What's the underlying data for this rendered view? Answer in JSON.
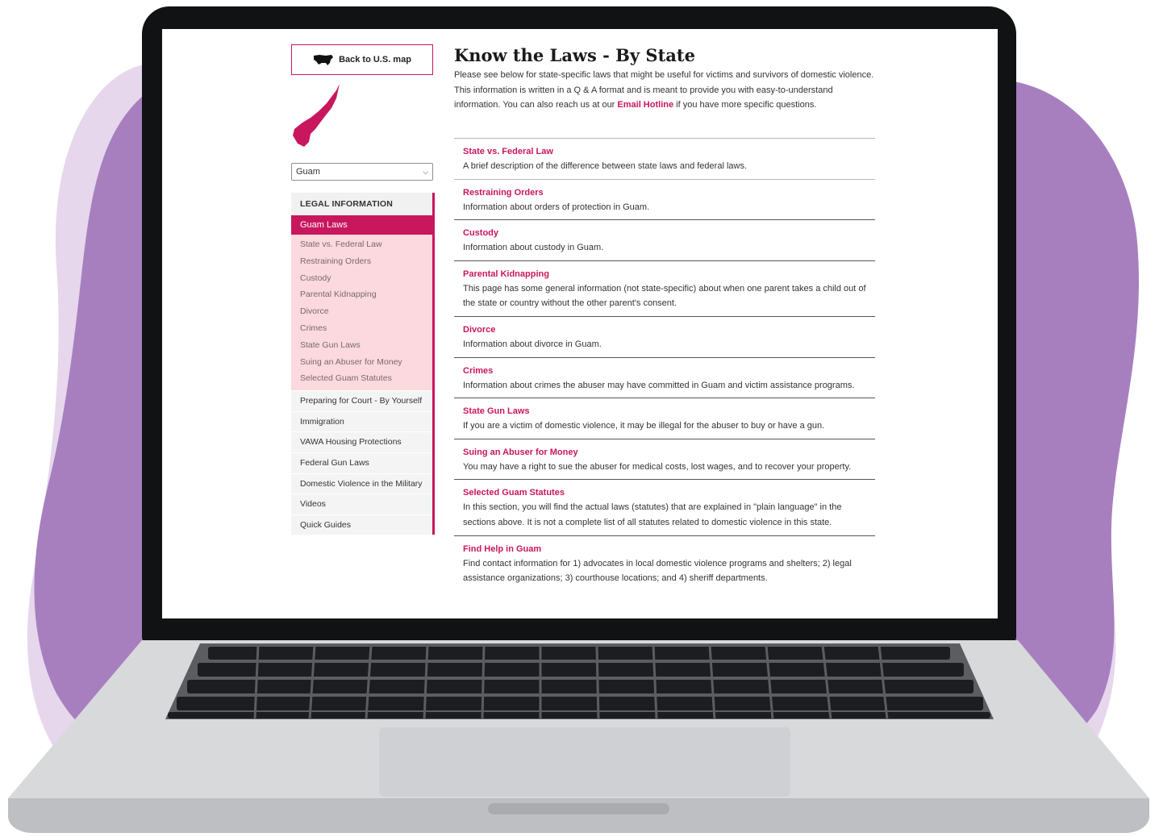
{
  "page": {
    "back_button": "Back to U.S. map",
    "selected_state": "Guam",
    "title": "Know the Laws - By State",
    "intro_before": "Please see below for state-specific laws that might be useful for victims and survivors of domestic violence. This information is written in a Q & A format and is meant to provide you with easy-to-understand information. You can also reach us at our ",
    "intro_link": "Email Hotline",
    "intro_after": " if you have more specific questions."
  },
  "sidebar": {
    "heading": "LEGAL INFORMATION",
    "active": "Guam Laws",
    "sub_items": [
      "State vs. Federal Law",
      "Restraining Orders",
      "Custody",
      "Parental Kidnapping",
      "Divorce",
      "Crimes",
      "State Gun Laws",
      "Suing an Abuser for Money",
      "Selected Guam Statutes"
    ],
    "items": [
      "Preparing for Court - By Yourself",
      "Immigration",
      "VAWA Housing Protections",
      "Federal Gun Laws",
      "Domestic Violence in the Military",
      "Videos",
      "Quick Guides"
    ]
  },
  "laws": [
    {
      "title": "State vs. Federal Law",
      "desc": "A brief description of the difference between state laws and federal laws."
    },
    {
      "title": "Restraining Orders",
      "desc": "Information about orders of protection in Guam."
    },
    {
      "title": "Custody",
      "desc": "Information about custody in Guam."
    },
    {
      "title": "Parental Kidnapping",
      "desc": "This page has some general information (not state-specific) about when one parent takes a child out of the state or country without the other parent's consent."
    },
    {
      "title": "Divorce",
      "desc": "Information about divorce in Guam."
    },
    {
      "title": "Crimes",
      "desc": "Information about crimes the abuser may have committed in Guam and victim assistance programs."
    },
    {
      "title": "State Gun Laws",
      "desc": "If you are a victim of domestic violence, it may be illegal for the abuser to buy or have a gun."
    },
    {
      "title": "Suing an Abuser for Money",
      "desc": "You may have a right to sue the abuser for medical costs, lost wages, and to recover your property."
    },
    {
      "title": "Selected Guam Statutes",
      "desc": "In this section, you will find the actual laws (statutes) that are explained in \"plain language\" in the sections above. It is not a complete list of all statutes related to domestic violence in this state."
    },
    {
      "title": "Find Help in Guam",
      "desc": "Find contact information for 1) advocates in local domestic violence programs and shelters; 2) legal assistance organizations; 3) courthouse locations; and 4) sheriff departments."
    }
  ],
  "colors": {
    "accent": "#c8175d",
    "sidebar_sub_bg": "#fbd9de",
    "blob_light": "#e6d7ec",
    "blob_dark": "#a77fbf"
  },
  "icons": {
    "back": "us-map-icon",
    "state": "guam-map-icon",
    "select": "chevron-down-icon"
  }
}
